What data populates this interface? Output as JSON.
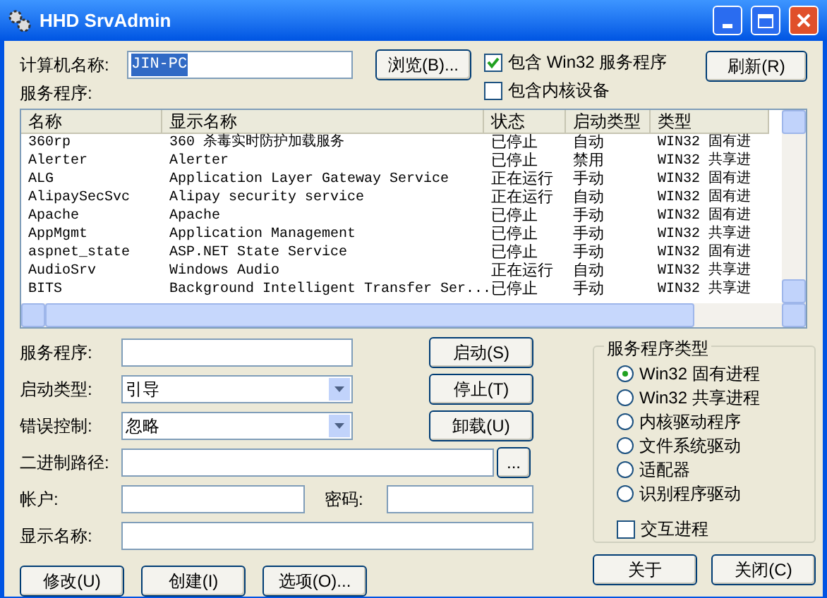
{
  "window": {
    "title": "HHD SrvAdmin"
  },
  "computer": {
    "label": "计算机名称:",
    "value": "JIN-PC"
  },
  "browse_button": "浏览(B)...",
  "checkboxes": [
    {
      "label": "包含 Win32 服务程序",
      "checked": true
    },
    {
      "label": "包含内核设备",
      "checked": false
    }
  ],
  "refresh_button": "刷新(R)",
  "services_label": "服务程序:",
  "table": {
    "columns": [
      "名称",
      "显示名称",
      "状态",
      "启动类型",
      "类型"
    ],
    "rows": [
      [
        "360rp",
        "360 杀毒实时防护加载服务",
        "已停止",
        "自动",
        "WIN32 固有进"
      ],
      [
        "Alerter",
        "Alerter",
        "已停止",
        "禁用",
        "WIN32 共享进"
      ],
      [
        "ALG",
        "Application Layer Gateway Service",
        "正在运行",
        "手动",
        "WIN32 固有进"
      ],
      [
        "AlipaySecSvc",
        "Alipay security service",
        "正在运行",
        "自动",
        "WIN32 固有进"
      ],
      [
        "Apache",
        "Apache",
        "已停止",
        "手动",
        "WIN32 固有进"
      ],
      [
        "AppMgmt",
        "Application Management",
        "已停止",
        "手动",
        "WIN32 共享进"
      ],
      [
        "aspnet_state",
        "ASP.NET State Service",
        "已停止",
        "手动",
        "WIN32 固有进"
      ],
      [
        "AudioSrv",
        "Windows Audio",
        "正在运行",
        "自动",
        "WIN32 共享进"
      ],
      [
        "BITS",
        "Background Intelligent Transfer Ser...",
        "已停止",
        "手动",
        "WIN32 共享进"
      ]
    ]
  },
  "form": [
    {
      "kind": "text",
      "label": "服务程序:",
      "button": "启动(S)"
    },
    {
      "kind": "select",
      "label": "启动类型:",
      "value": "引导",
      "button": "停止(T)"
    },
    {
      "kind": "select",
      "label": "错误控制:",
      "value": "忽略",
      "button": "卸载(U)"
    },
    {
      "kind": "path",
      "label": "二进制路径:",
      "button": "..."
    },
    {
      "kind": "account",
      "label": "帐户:",
      "second_label": "密码:"
    },
    {
      "kind": "wide",
      "label": "显示名称:"
    }
  ],
  "group": {
    "title": "服务程序类型",
    "options": [
      {
        "label": "Win32 固有进程",
        "selected": true
      },
      {
        "label": "Win32 共享进程",
        "selected": false
      },
      {
        "label": "内核驱动程序",
        "selected": false
      },
      {
        "label": "文件系统驱动",
        "selected": false
      },
      {
        "label": "适配器",
        "selected": false
      },
      {
        "label": "识别程序驱动",
        "selected": false
      }
    ],
    "interactive": {
      "label": "交互进程",
      "checked": false
    }
  },
  "bottom_buttons": [
    "修改(U)",
    "创建(I)",
    "选项(O)..."
  ],
  "right_buttons": [
    "关于",
    "关闭(C)"
  ]
}
